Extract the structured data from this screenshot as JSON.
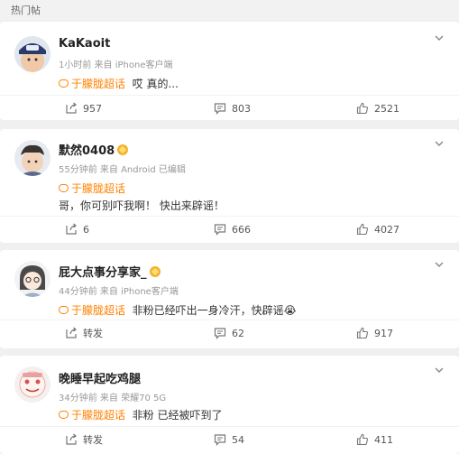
{
  "header": {
    "title": "热门帖"
  },
  "posts": [
    {
      "username": "KaKaoit",
      "has_badge": false,
      "meta": "1小时前  来自 iPhone客户端",
      "topic": "于朦胧超话",
      "text": "哎 真的...",
      "share": "957",
      "comment": "803",
      "like": "2521"
    },
    {
      "username": "默然0408",
      "has_badge": true,
      "meta": "55分钟前  来自 Android 已编辑",
      "topic": "于朦胧超话",
      "text": "哥，你可别吓我啊！ 快出来辟谣！",
      "share": "6",
      "comment": "666",
      "like": "4027"
    },
    {
      "username": "屁大点事分享家_",
      "has_badge": true,
      "meta": "44分钟前  来自 iPhone客户端",
      "topic": "于朦胧超话",
      "text": "非粉已经吓出一身冷汗，快辟谣😭",
      "share": "转发",
      "comment": "62",
      "like": "917"
    },
    {
      "username": "晚睡早起吃鸡腿",
      "has_badge": false,
      "meta": "34分钟前  来自 荣耀70 5G",
      "topic": "于朦胧超话",
      "text": "非粉 已经被吓到了",
      "share": "转发",
      "comment": "54",
      "like": "411"
    }
  ],
  "icons": {
    "share": "share-icon",
    "comment": "comment-icon",
    "like": "thumb-up-icon",
    "menu": "chevron-down-icon",
    "topic": "super-topic-icon",
    "badge": "vip-badge-icon"
  },
  "colors": {
    "topic": "#ff8200",
    "meta": "#999999",
    "background": "#f0f0f0"
  }
}
